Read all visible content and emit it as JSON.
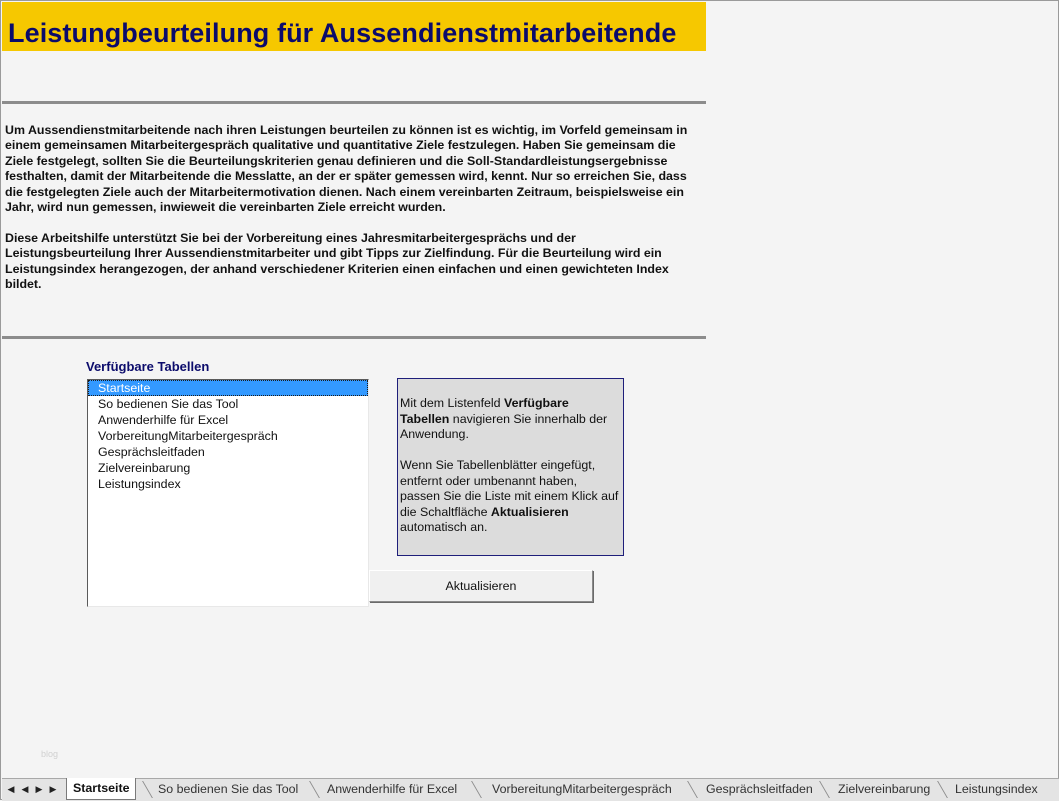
{
  "header": {
    "title": "Leistungbeurteilung für Aussendienstmitarbeitende"
  },
  "intro": {
    "paragraph1": "Um Aussendienstmitarbeitende  nach ihren Leistungen  beurteilen zu können ist es wichtig, im Vorfeld gemeinsam in einem gemeinsamen Mitarbeitergespräch qualitative und quantitative Ziele festzulegen. Haben Sie gemeinsam die Ziele festgelegt, sollten  Sie die Beurteilungskriterien genau definieren und die Soll-Standardleistungsergebnisse  festhalten,  damit der Mitarbeitende die Messlatte, an der er später gemessen wird, kennt. Nur so  erreichen Sie, dass die festgelegten Ziele auch der Mitarbeitermotivation dienen. Nach einem vereinbarten Zeitraum, beispielsweise ein Jahr, wird nun gemessen, inwieweit die vereinbarten Ziele erreicht wurden.",
    "paragraph2": "Diese Arbeitshilfe unterstützt  Sie bei der Vorbereitung eines Jahresmitarbeitergesprächs  und der Leistungsbeurteilung  Ihrer Aussendienstmitarbeiter  und gibt Tipps zur Zielfindung. Für die Beurteilung wird ein Leistungsindex herangezogen, der anhand verschiedener Kriterien einen einfachen und einen gewichteten Index bildet."
  },
  "tables": {
    "label": "Verfügbare Tabellen",
    "items": [
      {
        "label": "Startseite",
        "selected": true
      },
      {
        "label": "So bedienen Sie das Tool",
        "selected": false
      },
      {
        "label": "Anwenderhilfe für Excel",
        "selected": false
      },
      {
        "label": "VorbereitungMitarbeitergespräch",
        "selected": false
      },
      {
        "label": "Gesprächsleitfaden",
        "selected": false
      },
      {
        "label": "Zielvereinbarung",
        "selected": false
      },
      {
        "label": "Leistungsindex",
        "selected": false
      }
    ]
  },
  "info": {
    "p1_pre": "Mit dem Listenfeld ",
    "p1_bold": "Verfügbare Tabellen",
    "p1_post": " navigieren  Sie innerhalb der Anwendung.",
    "p2_pre": "Wenn Sie Tabellenblätter  eingefügt, entfernt  oder umbenannt  haben, passen Sie die Liste mit einem Klick auf die Schaltfläche ",
    "p2_bold": "Aktualisieren",
    "p2_post": " automatisch an."
  },
  "refresh_button": {
    "label": "Aktualisieren"
  },
  "watermark": "blog",
  "sheet_nav": {
    "first": "◀",
    "prev": "◀",
    "next": "▶",
    "last": "▶"
  },
  "sheet_tabs": [
    {
      "label": "Startseite",
      "active": true
    },
    {
      "label": "So bedienen Sie das Tool",
      "active": false
    },
    {
      "label": "Anwenderhilfe für Excel",
      "active": false
    },
    {
      "label": "VorbereitungMitarbeitergespräch",
      "active": false
    },
    {
      "label": "Gesprächsleitfaden",
      "active": false
    },
    {
      "label": "Zielvereinbarung",
      "active": false
    },
    {
      "label": "Leistungsindex",
      "active": false
    }
  ],
  "colors": {
    "title_bg": "#f6c800",
    "title_text": "#0b0b6b",
    "selection": "#3399ff",
    "info_bg": "#dcdcdc"
  }
}
